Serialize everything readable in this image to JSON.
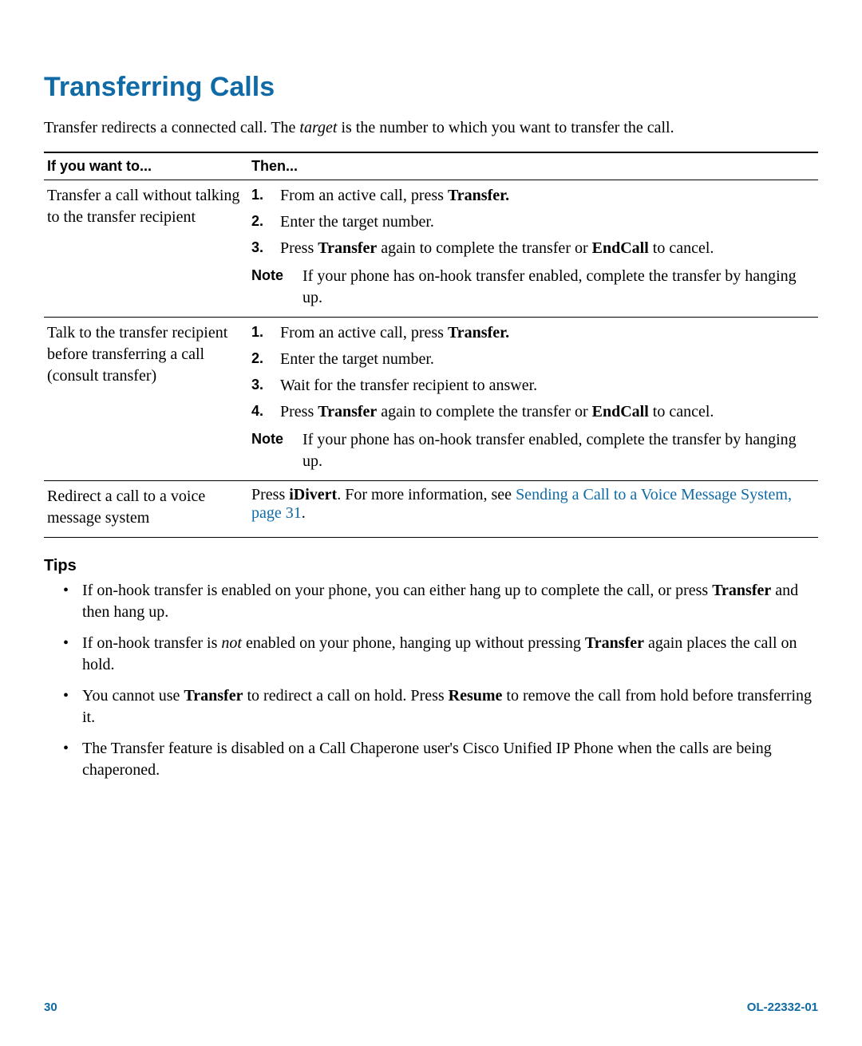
{
  "title": "Transferring Calls",
  "intro": {
    "p1a": "Transfer redirects a connected call. The ",
    "p1b": "target",
    "p1c": " is the number to which you want to transfer the call."
  },
  "table": {
    "h1": "If you want to...",
    "h2": "Then...",
    "r1": {
      "col1": "Transfer a call without talking to the transfer recipient",
      "s1n": "1.",
      "s1a": "From an active call, press ",
      "s1b": "Transfer.",
      "s2n": "2.",
      "s2a": "Enter the target number.",
      "s3n": "3.",
      "s3a": "Press ",
      "s3b": "Transfer",
      "s3c": " again to complete the transfer or ",
      "s3d": "EndCall",
      "s3e": " to cancel.",
      "note_label": "Note",
      "note_text": "If your phone has on-hook transfer enabled, complete the transfer by hanging up."
    },
    "r2": {
      "col1": "Talk to the transfer recipient before transferring a call (consult transfer)",
      "s1n": "1.",
      "s1a": "From an active call, press ",
      "s1b": "Transfer.",
      "s2n": "2.",
      "s2a": "Enter the target number.",
      "s3n": "3.",
      "s3a": "Wait for the transfer recipient to answer.",
      "s4n": "4.",
      "s4a": "Press ",
      "s4b": "Transfer",
      "s4c": " again to complete the transfer or ",
      "s4d": "EndCall",
      "s4e": " to cancel.",
      "note_label": "Note",
      "note_text": "If your phone has on-hook transfer enabled, complete the transfer by hanging up."
    },
    "r3": {
      "col1": "Redirect a call to a voice message system",
      "ta": "Press ",
      "tb": "iDivert",
      "tc": ". For more information, see ",
      "td": "Sending a Call to a Voice Message System, page 31",
      "te": "."
    }
  },
  "tips_heading": "Tips",
  "tips": {
    "t1a": "If on-hook transfer is enabled on your phone, you can either hang up to complete the call, or press ",
    "t1b": "Transfer",
    "t1c": " and then hang up.",
    "t2a": "If on-hook transfer is ",
    "t2b": "not",
    "t2c": " enabled on your phone, hanging up without pressing ",
    "t2d": "Transfer",
    "t2e": " again places the call on hold.",
    "t3a": "You cannot use ",
    "t3b": "Transfer",
    "t3c": " to redirect a call on hold. Press ",
    "t3d": "Resume",
    "t3e": " to remove the call from hold before transferring it.",
    "t4": "The Transfer feature is disabled on a Call Chaperone user's Cisco Unified IP Phone when the calls are being chaperoned."
  },
  "footer": {
    "page": "30",
    "docid": "OL-22332-01"
  }
}
